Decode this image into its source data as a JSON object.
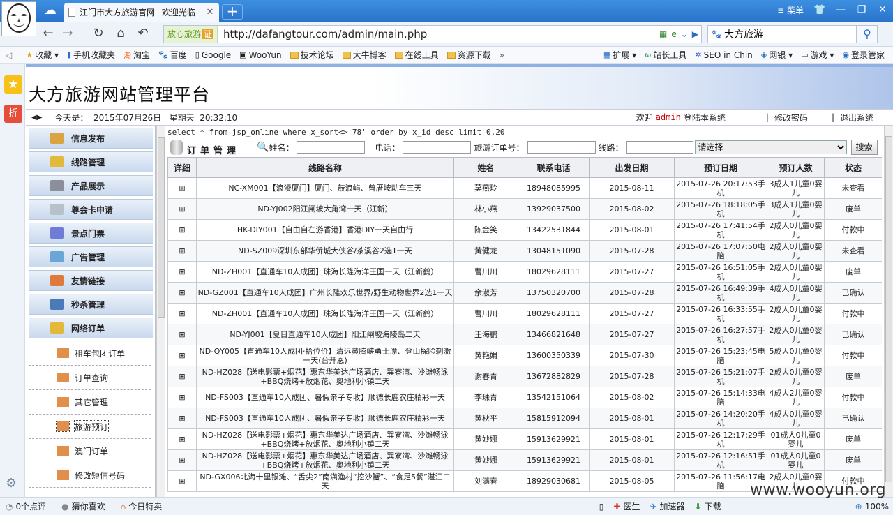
{
  "browser": {
    "tab_title": "江门市大方旅游官网– 欢迎光临",
    "menu_label": "菜单",
    "address": {
      "tag": "放心旅游",
      "tag_badge": "证",
      "url": "http://dafangtour.com/admin/main.php"
    },
    "search": {
      "value": "大方旅游"
    },
    "bookmarks": [
      {
        "label": "收藏",
        "icon": "star-icon"
      },
      {
        "label": "手机收藏夹",
        "icon": "phone-icon"
      },
      {
        "label": "淘宝",
        "icon": "taobao-icon"
      },
      {
        "label": "百度",
        "icon": "baidu-icon"
      },
      {
        "label": "Google",
        "icon": "page-icon"
      },
      {
        "label": "WooYun",
        "icon": "wooyun-icon"
      },
      {
        "label": "技术论坛",
        "icon": "folder-icon"
      },
      {
        "label": "大牛博客",
        "icon": "folder-icon"
      },
      {
        "label": "在线工具",
        "icon": "folder-icon"
      },
      {
        "label": "资源下载",
        "icon": "folder-icon"
      }
    ],
    "bookmarks_right": [
      {
        "label": "扩展",
        "icon": "grid-icon"
      },
      {
        "label": "站长工具",
        "icon": "w-icon"
      },
      {
        "label": "SEO in Chin",
        "icon": "seo-icon"
      },
      {
        "label": "网银",
        "icon": "bank-icon"
      },
      {
        "label": "游戏",
        "icon": "game-icon"
      },
      {
        "label": "登录管家",
        "icon": "user-icon"
      }
    ],
    "status": {
      "left": [
        {
          "label": "0个点评",
          "icon": "comment-icon"
        },
        {
          "label": "猜你喜欢",
          "icon": "like-icon"
        },
        {
          "label": "今日特卖",
          "icon": "gift-icon"
        }
      ],
      "right": [
        {
          "label": "医生",
          "icon": "doctor-icon"
        },
        {
          "label": "加速器",
          "icon": "speed-icon"
        },
        {
          "label": "下载",
          "icon": "download-icon"
        }
      ],
      "zoom": "100%"
    },
    "watermark": "www.wooyun.org"
  },
  "site": {
    "title": "大方旅游网站管理平台",
    "today_label": "今天是：",
    "date": "2015年07月26日",
    "weekday": "星期天",
    "time": "20:32:10",
    "welcome_pre": "欢迎",
    "admin": "admin",
    "welcome_post": "登陆本系统",
    "change_password": "修改密码",
    "logout": "退出系统"
  },
  "menu": {
    "sections": [
      {
        "label": "信息发布",
        "color": "#d9a441"
      },
      {
        "label": "线路管理",
        "color": "#e2b93b"
      },
      {
        "label": "产品展示",
        "color": "#8a8f99"
      },
      {
        "label": "尊会卡申请",
        "color": "#b8c0cc"
      },
      {
        "label": "景点门票",
        "color": "#6f7bd6"
      },
      {
        "label": "广告管理",
        "color": "#6aa6d6"
      },
      {
        "label": "友情链接",
        "color": "#e07a3a"
      },
      {
        "label": "秒杀管理",
        "color": "#4a7ab8"
      },
      {
        "label": "网络订单",
        "color": "#e2b93b"
      }
    ],
    "subitems": [
      "租车包团订单",
      "订单查询",
      "其它管理",
      "旅游预订",
      "澳门订单",
      "修改短信号码"
    ],
    "active_subitem": "旅游预订"
  },
  "main": {
    "sql": "select * from jsp_online where x_sort<>'78' order by x_id desc limit 0,20",
    "panel_title": "订单管理",
    "filter": {
      "name_label": "姓名：",
      "phone_label": "电话：",
      "order_no_label": "旅游订单号：",
      "route_label": "线路：",
      "select_value": "请选择",
      "search_label": "搜索"
    },
    "columns": [
      "详细",
      "线路名称",
      "姓名",
      "联系电话",
      "出发日期",
      "预订日期",
      "预订人数",
      "状态"
    ],
    "rows": [
      [
        "⊞",
        "NC-XM001【浪漫厦门】厦门、鼓浪屿、曾厝垵动车三天",
        "莫燕玲",
        "18948085995",
        "2015-08-11",
        "2015-07-26 20:17:53手机",
        "3成人1儿童0婴儿",
        "未查看"
      ],
      [
        "⊞",
        "ND-YJ002阳江闸坡大角湾一天（江新）",
        "林小燕",
        "13929037500",
        "2015-08-02",
        "2015-07-26 18:18:05手机",
        "3成人1儿童0婴儿",
        "废单"
      ],
      [
        "⊞",
        "HK-DIY001【自由自在游香港】香港DIY一天自由行",
        "陈金笑",
        "13422531844",
        "2015-08-01",
        "2015-07-26 17:41:54手机",
        "2成人0儿童0婴儿",
        "付款中"
      ],
      [
        "⊞",
        "ND-SZ009深圳东部华侨城大侠谷/茶溪谷2选1一天",
        "黄健龙",
        "13048151090",
        "2015-07-28",
        "2015-07-26 17:07:50电脑",
        "2成人0儿童0婴儿",
        "未查看"
      ],
      [
        "⊞",
        "ND-ZH001【直通车10人成团】珠海长隆海洋王国一天（江新鹤）",
        "曹川川",
        "18029628111",
        "2015-07-27",
        "2015-07-26 16:51:05手机",
        "2成人0儿童0婴儿",
        "废单"
      ],
      [
        "⊞",
        "ND-GZ001【直通车10人成团】广州长隆欢乐世界/野生动物世界2选1一天",
        "余淑芳",
        "13750320700",
        "2015-07-28",
        "2015-07-26 16:49:39手机",
        "4成人0儿童0婴儿",
        "已确认"
      ],
      [
        "⊞",
        "ND-ZH001【直通车10人成团】珠海长隆海洋王国一天（江新鹤）",
        "曹川川",
        "18029628111",
        "2015-07-27",
        "2015-07-26 16:33:55手机",
        "2成人0儿童0婴儿",
        "付款中"
      ],
      [
        "⊞",
        "ND-YJ001【夏日直通车10人成团】阳江闸坡海陵岛二天",
        "王海鹏",
        "13466821648",
        "2015-07-27",
        "2015-07-26 16:27:57手机",
        "2成人0儿童0婴儿",
        "已确认"
      ],
      [
        "⊞",
        "ND-QY005【直通车10人成团·拾位价】清远黄腾峡勇士漂、登山探险刺激一天(台开恩)",
        "黄艳娟",
        "13600350339",
        "2015-07-30",
        "2015-07-26 15:23:45电脑",
        "5成人0儿童0婴儿",
        "付款中"
      ],
      [
        "⊞",
        "ND-HZ028【送电影票+烟花】惠东华美达广场酒店、巽寮湾、沙滩畅泳+BBQ烧烤+放烟花、奥地利小镇二天",
        "谢春青",
        "13672882829",
        "2015-07-28",
        "2015-07-26 15:21:07手机",
        "2成人0儿童0婴儿",
        "废单"
      ],
      [
        "⊞",
        "ND-FS003【直通车10人成团、暑假亲子专收】顺德长鹿农庄精彩一天",
        "李珠青",
        "13542151064",
        "2015-08-02",
        "2015-07-26 15:14:33电脑",
        "4成人2儿童0婴儿",
        "付款中"
      ],
      [
        "⊞",
        "ND-FS003【直通车10人成团、暑假亲子专收】顺德长鹿农庄精彩一天",
        "黄秋平",
        "15815912094",
        "2015-08-01",
        "2015-07-26 14:20:20手机",
        "4成人0儿童0婴儿",
        "已确认"
      ],
      [
        "⊞",
        "ND-HZ028【送电影票+烟花】惠东华美达广场酒店、巽寮湾、沙滩畅泳+BBQ烧烤+放烟花、奥地利小镇二天",
        "黄妙娜",
        "15913629921",
        "2015-08-01",
        "2015-07-26 12:17:29手机",
        "01成人0儿童0婴儿",
        "废单"
      ],
      [
        "⊞",
        "ND-HZ028【送电影票+烟花】惠东华美达广场酒店、巽寮湾、沙滩畅泳+BBQ烧烤+放烟花、奥地利小镇二天",
        "黄妙娜",
        "15913629921",
        "2015-08-01",
        "2015-07-26 12:16:51手机",
        "01成人0儿童0婴儿",
        "废单"
      ],
      [
        "⊞",
        "ND-GX006北海十里银滩、“舌尖2”南澫渔村“挖沙蟹”、“食足5餐”湛江二天",
        "刘满春",
        "18929030681",
        "2015-08-05",
        "2015-07-26 11:56:17电脑",
        "2成人0儿童0婴儿",
        "付款中"
      ]
    ]
  }
}
